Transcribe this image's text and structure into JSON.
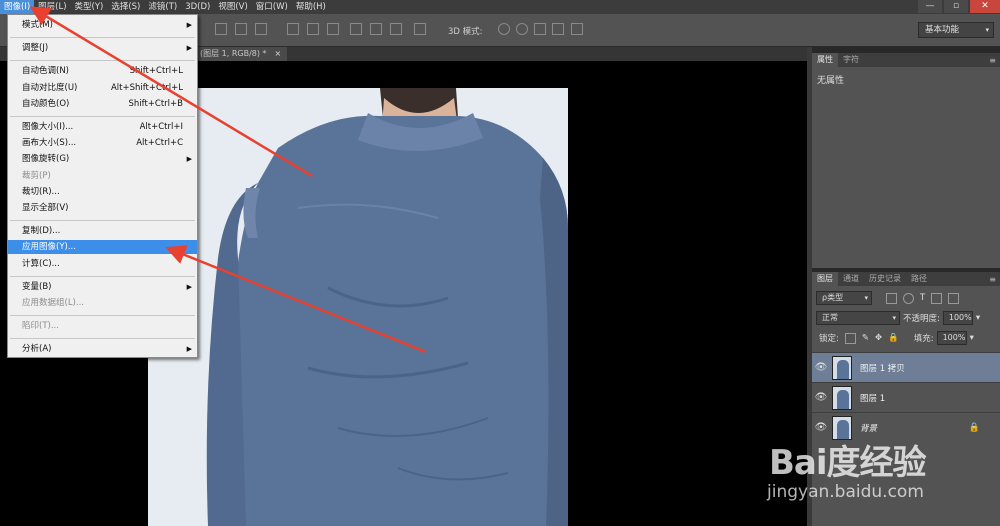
{
  "menubar": {
    "items": [
      "图像(I)",
      "图层(L)",
      "类型(Y)",
      "选择(S)",
      "滤镜(T)",
      "3D(D)",
      "视图(V)",
      "窗口(W)",
      "帮助(H)"
    ],
    "active_index": 0
  },
  "window_controls": {
    "minimize": "—",
    "restore": "▫",
    "close": "✕"
  },
  "optbar": {
    "mode_label": "3D 模式:",
    "workspace": "基本功能"
  },
  "doc_tab": {
    "title": "(图层 1, RGB/8) *",
    "close": "×"
  },
  "image_menu": {
    "items": [
      {
        "label": "模式(M)",
        "submenu": true
      },
      {
        "separator": true
      },
      {
        "label": "调整(J)",
        "submenu": true
      },
      {
        "separator": true
      },
      {
        "label": "自动色调(N)",
        "shortcut": "Shift+Ctrl+L"
      },
      {
        "label": "自动对比度(U)",
        "shortcut": "Alt+Shift+Ctrl+L"
      },
      {
        "label": "自动颜色(O)",
        "shortcut": "Shift+Ctrl+B"
      },
      {
        "separator": true
      },
      {
        "label": "图像大小(I)...",
        "shortcut": "Alt+Ctrl+I"
      },
      {
        "label": "画布大小(S)...",
        "shortcut": "Alt+Ctrl+C"
      },
      {
        "label": "图像旋转(G)",
        "submenu": true
      },
      {
        "label": "裁剪(P)",
        "disabled": true
      },
      {
        "label": "裁切(R)..."
      },
      {
        "label": "显示全部(V)"
      },
      {
        "separator": true
      },
      {
        "label": "复制(D)..."
      },
      {
        "label": "应用图像(Y)...",
        "highlighted": true
      },
      {
        "label": "计算(C)..."
      },
      {
        "separator": true
      },
      {
        "label": "变量(B)",
        "submenu": true
      },
      {
        "label": "应用数据组(L)...",
        "disabled": true
      },
      {
        "separator": true
      },
      {
        "label": "陷印(T)...",
        "disabled": true
      },
      {
        "separator": true
      },
      {
        "label": "分析(A)",
        "submenu": true
      }
    ]
  },
  "properties_panel": {
    "tabs": [
      "属性",
      "字符"
    ],
    "empty_text": "无属性"
  },
  "layers_panel": {
    "tabs": [
      "图层",
      "通道",
      "历史记录",
      "路径"
    ],
    "filter_kind": "ρ类型",
    "blend_mode": "正常",
    "opacity_label": "不透明度:",
    "opacity_value": "100%",
    "lock_label": "锁定:",
    "fill_label": "填充:",
    "fill_value": "100%",
    "layers": [
      {
        "name": "图层 1 拷贝",
        "selected": true,
        "locked": false
      },
      {
        "name": "图层 1",
        "selected": false,
        "locked": false
      },
      {
        "name": "背景",
        "selected": false,
        "locked": true
      }
    ]
  },
  "watermark": {
    "logo": "Bai度经验",
    "url": "jingyan.baidu.com"
  },
  "colors": {
    "accent": "#3d8ee8",
    "arrow": "#e8412f",
    "shirt": "#5a7398"
  }
}
